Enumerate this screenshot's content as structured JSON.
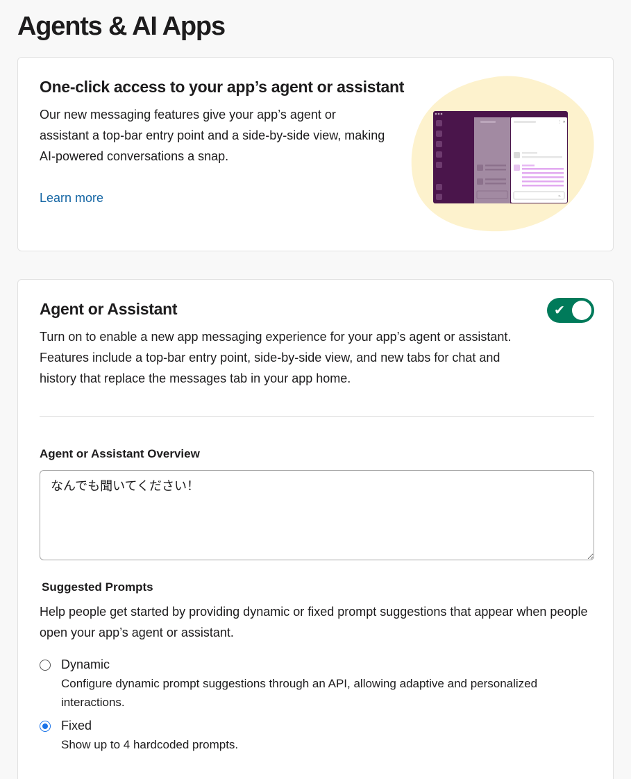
{
  "page": {
    "title": "Agents & AI Apps"
  },
  "promo": {
    "heading": "One-click access to your app’s agent or assistant",
    "body": "Our new messaging features give your app’s agent or assistant a top-bar entry point and a side-by-side view, making AI-powered conversations a snap.",
    "learn_more": "Learn more",
    "illustration_icon": "slack-side-by-side-illustration"
  },
  "agent": {
    "heading": "Agent or Assistant",
    "toggle_on": true,
    "toggle_check": "✔",
    "body": "Turn on to enable a new app messaging experience for your app’s agent or assistant. Features include a top-bar entry point, side-by-side view, and new tabs for chat and history that replace the messages tab in your app home.",
    "overview_label": "Agent or Assistant Overview",
    "overview_value": "なんでも聞いてください！",
    "suggested_prompts": {
      "label": "Suggested Prompts",
      "description": "Help people get started by providing dynamic or fixed prompt suggestions that appear when people open your app’s agent or assistant.",
      "selected": "Fixed",
      "options": [
        {
          "title": "Dynamic",
          "description": "Configure dynamic prompt suggestions through an API, allowing adaptive and personalized interactions."
        },
        {
          "title": "Fixed",
          "description": "Show up to 4 hardcoded prompts."
        }
      ]
    }
  },
  "colors": {
    "toggle_on": "#007a5a",
    "link": "#1264a3",
    "radio_selected": "#1a73e8",
    "illustration_blob": "#fdf2cd",
    "illustration_sidebar": "#4a154b"
  }
}
